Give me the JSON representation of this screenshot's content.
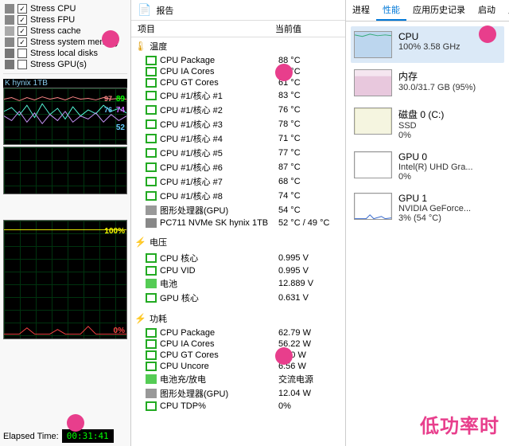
{
  "left": {
    "checks": [
      {
        "label": "Stress CPU",
        "checked": true,
        "icon": "cpu"
      },
      {
        "label": "Stress FPU",
        "checked": true,
        "icon": "fpu"
      },
      {
        "label": "Stress cache",
        "checked": true,
        "icon": "cache"
      },
      {
        "label": "Stress system memory",
        "checked": true,
        "icon": "mem"
      },
      {
        "label": "Stress local disks",
        "checked": false,
        "icon": "disk"
      },
      {
        "label": "Stress GPU(s)",
        "checked": false,
        "icon": "gpu"
      }
    ],
    "disk_label": "K hynix 1TB",
    "graph1": {
      "r1": "89",
      "r2": "74",
      "r3": "52",
      "color1": "#5fd",
      "color2": "#9cf",
      "color3": "#f6a",
      "numcolor1": "#0f0",
      "numcolor2": "#c6f",
      "numcolor3": "#6cf"
    },
    "graph2": {
      "top": "100%",
      "bot": "0%"
    },
    "elapsed_label": "Elapsed Time:",
    "elapsed_value": "00:31:41",
    "graph1_extra": "97 76"
  },
  "middle": {
    "report": "报告",
    "cols": {
      "c1": "项目",
      "c2": "当前值"
    },
    "sections": [
      {
        "title": "温度",
        "icon": "🌡",
        "rows": [
          {
            "ic": "sq-g",
            "l": "CPU Package",
            "v": "88 °C"
          },
          {
            "ic": "sq-g",
            "l": "CPU IA Cores",
            "v": "88 °C"
          },
          {
            "ic": "sq-g",
            "l": "CPU GT Cores",
            "v": "61 °C"
          },
          {
            "ic": "sq-g",
            "l": "CPU #1/核心 #1",
            "v": "83 °C"
          },
          {
            "ic": "sq-g",
            "l": "CPU #1/核心 #2",
            "v": "76 °C"
          },
          {
            "ic": "sq-g",
            "l": "CPU #1/核心 #3",
            "v": "78 °C"
          },
          {
            "ic": "sq-g",
            "l": "CPU #1/核心 #4",
            "v": "71 °C"
          },
          {
            "ic": "sq-g",
            "l": "CPU #1/核心 #5",
            "v": "77 °C"
          },
          {
            "ic": "sq-g",
            "l": "CPU #1/核心 #6",
            "v": "87 °C"
          },
          {
            "ic": "sq-g",
            "l": "CPU #1/核心 #7",
            "v": "68 °C"
          },
          {
            "ic": "sq-g",
            "l": "CPU #1/核心 #8",
            "v": "74 °C"
          },
          {
            "ic": "gpu",
            "l": "图形处理器(GPU)",
            "v": "54 °C"
          },
          {
            "ic": "hdd",
            "l": "PC711 NVMe SK hynix 1TB",
            "v": "52 °C / 49 °C"
          }
        ]
      },
      {
        "title": "电压",
        "icon": "⚡",
        "rows": [
          {
            "ic": "sq-g",
            "l": "CPU 核心",
            "v": "0.995 V"
          },
          {
            "ic": "sq-g",
            "l": "CPU VID",
            "v": "0.995 V"
          },
          {
            "ic": "batt",
            "l": "电池",
            "v": "12.889 V"
          },
          {
            "ic": "sq-g",
            "l": "GPU 核心",
            "v": "0.631 V"
          }
        ]
      },
      {
        "title": "功耗",
        "icon": "⚡",
        "rows": [
          {
            "ic": "sq-g",
            "l": "CPU Package",
            "v": "62.79 W"
          },
          {
            "ic": "sq-g",
            "l": "CPU IA Cores",
            "v": "56.22 W"
          },
          {
            "ic": "sq-g",
            "l": "CPU GT Cores",
            "v": "0.00 W"
          },
          {
            "ic": "sq-g",
            "l": "CPU Uncore",
            "v": "6.56 W"
          },
          {
            "ic": "batt",
            "l": "电池充/放电",
            "v": "交流电源"
          },
          {
            "ic": "gpu",
            "l": "图形处理器(GPU)",
            "v": "12.04 W"
          },
          {
            "ic": "sq-g",
            "l": "CPU TDP%",
            "v": "0%"
          }
        ]
      }
    ]
  },
  "right": {
    "tabs": [
      "进程",
      "性能",
      "应用历史记录",
      "启动",
      "用"
    ],
    "active_tab": 1,
    "cards": [
      {
        "t1": "CPU",
        "t2": "100% 3.58 GHz",
        "t3": "",
        "thumb": "cpu"
      },
      {
        "t1": "内存",
        "t2": "30.0/31.7 GB (95%)",
        "t3": "",
        "thumb": "mem"
      },
      {
        "t1": "磁盘 0 (C:)",
        "t2": "SSD",
        "t3": "0%",
        "thumb": "disk"
      },
      {
        "t1": "GPU 0",
        "t2": "Intel(R) UHD Gra...",
        "t3": "0%",
        "thumb": "gpu0"
      },
      {
        "t1": "GPU 1",
        "t2": "NVIDIA GeForce...",
        "t3": "3% (54 °C)",
        "thumb": "gpu1"
      }
    ]
  },
  "watermark": "低功率时"
}
